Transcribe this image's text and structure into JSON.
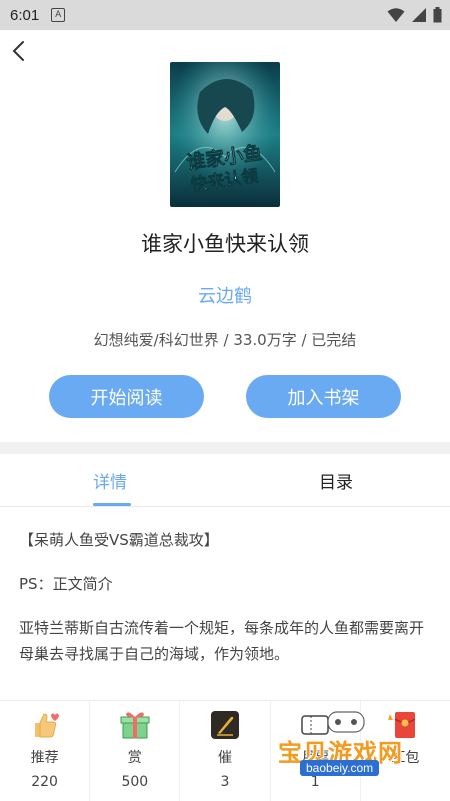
{
  "status_bar": {
    "time": "6:01",
    "notification_badge": "A"
  },
  "book": {
    "title": "谁家小鱼快来认领",
    "author": "云边鹤",
    "meta": "幻想纯爱/科幻世界 / 33.0万字 / 已完结",
    "cover_title": "谁家小鱼快来认领"
  },
  "actions": {
    "read_label": "开始阅读",
    "shelf_label": "加入书架"
  },
  "tabs": [
    {
      "label": "详情",
      "active": true
    },
    {
      "label": "目录",
      "active": false
    }
  ],
  "description": {
    "tagline": "【呆萌人鱼受VS霸道总裁攻】",
    "ps": "PS：正文简介",
    "body": "亚特兰蒂斯自古流传着一个规矩，每条成年的人鱼都需要离开母巢去寻找属于自己的海域，作为领地。"
  },
  "bottom_bar": [
    {
      "label": "推荐",
      "count": "220",
      "icon": "thumbs-up-heart-icon"
    },
    {
      "label": "赏",
      "count": "500",
      "icon": "gift-box-icon"
    },
    {
      "label": "催",
      "count": "3",
      "icon": "quill-pen-icon"
    },
    {
      "label": "月票",
      "count": "1",
      "icon": "ticket-icon"
    },
    {
      "label": "红包",
      "count": "",
      "icon": "red-envelope-icon"
    }
  ],
  "watermark": {
    "text": "宝贝游戏网",
    "url": "baobeiy.com"
  },
  "colors": {
    "accent": "#6aa9f1",
    "button": "#6aaaf3",
    "statusbar": "#dadada"
  }
}
